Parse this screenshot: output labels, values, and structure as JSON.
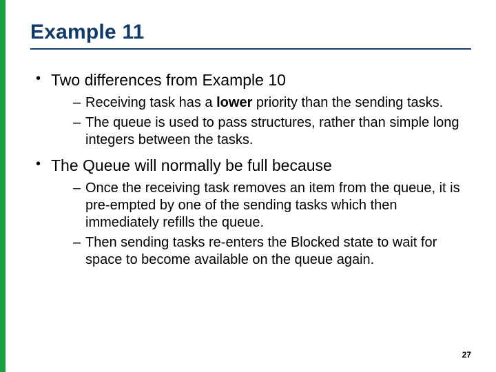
{
  "title": "Example 11",
  "bullets": [
    {
      "text": "Two differences from Example 10",
      "sub": [
        {
          "prefix": "Receiving task has a ",
          "bold": "lower",
          "suffix": " priority than the sending tasks."
        },
        {
          "prefix": "The queue is used to pass structures, rather than simple long integers between the tasks.",
          "bold": "",
          "suffix": ""
        }
      ]
    },
    {
      "text": "The Queue will normally be full because",
      "sub": [
        {
          "prefix": "Once the receiving task removes an item from the queue, it is pre-empted by one of the sending tasks which then immediately refills the queue.",
          "bold": "",
          "suffix": ""
        },
        {
          "prefix": "Then sending tasks re-enters the Blocked state to wait for space to become available on the queue again.",
          "bold": "",
          "suffix": ""
        }
      ]
    }
  ],
  "page_number": "27"
}
